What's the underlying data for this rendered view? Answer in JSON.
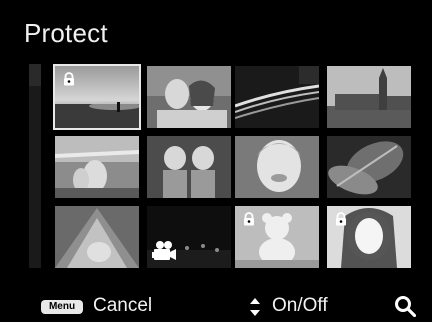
{
  "screen": {
    "title": "Protect"
  },
  "grid": {
    "thumbnails": [
      {
        "subject": "beach-sunset",
        "protected": true,
        "selected": true,
        "movie": false
      },
      {
        "subject": "couple-portrait",
        "protected": false,
        "selected": false,
        "movie": false
      },
      {
        "subject": "night-traffic",
        "protected": false,
        "selected": false,
        "movie": false
      },
      {
        "subject": "big-ben",
        "protected": false,
        "selected": false,
        "movie": false
      },
      {
        "subject": "airplane-people",
        "protected": false,
        "selected": false,
        "movie": false
      },
      {
        "subject": "twin-children",
        "protected": false,
        "selected": false,
        "movie": false
      },
      {
        "subject": "smiling-child",
        "protected": false,
        "selected": false,
        "movie": false
      },
      {
        "subject": "leaves",
        "protected": false,
        "selected": false,
        "movie": false
      },
      {
        "subject": "baby-and-tent",
        "protected": false,
        "selected": false,
        "movie": false
      },
      {
        "subject": "night-city",
        "protected": false,
        "selected": false,
        "movie": true
      },
      {
        "subject": "teddy-bear",
        "protected": true,
        "selected": false,
        "movie": false
      },
      {
        "subject": "woman-portrait",
        "protected": true,
        "selected": false,
        "movie": false
      }
    ]
  },
  "footer": {
    "menu_key_label": "Menu",
    "cancel_label": "Cancel",
    "onoff_label": "On/Off"
  },
  "icons": {
    "lock": "lock-icon",
    "movie": "movie-camera-icon",
    "updown": "up-down-arrow-icon",
    "zoom": "magnifier-icon"
  }
}
